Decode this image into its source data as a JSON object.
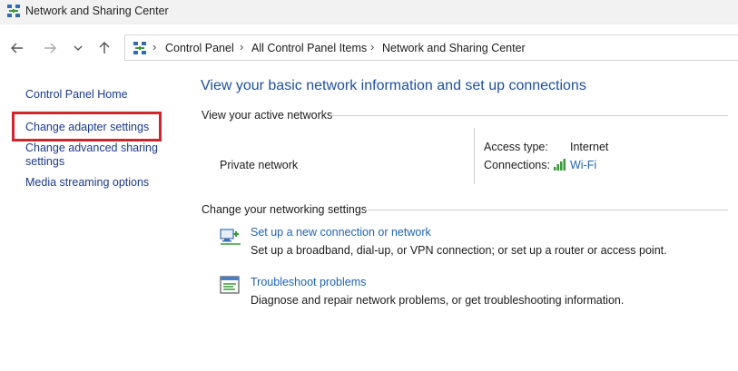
{
  "window": {
    "title": "Network and Sharing Center"
  },
  "address": {
    "breadcrumbs": [
      "Control Panel",
      "All Control Panel Items",
      "Network and Sharing Center"
    ]
  },
  "sidebar": {
    "items": [
      {
        "label": "Control Panel Home"
      },
      {
        "label": "Change adapter settings",
        "highlighted": true
      },
      {
        "label_line1": "Change advanced sharing",
        "label_line2": "settings"
      },
      {
        "label": "Media streaming options"
      }
    ]
  },
  "main": {
    "heading": "View your basic network information and set up connections",
    "active_networks_label": "View your active networks",
    "network": {
      "name": "Private network",
      "access_type_label": "Access type:",
      "access_type_value": "Internet",
      "connections_label": "Connections:",
      "connections_value": "Wi-Fi"
    },
    "change_settings_label": "Change your networking settings",
    "tasks": [
      {
        "icon": "new-connection-icon",
        "title": "Set up a new connection or network",
        "description": "Set up a broadband, dial-up, or VPN connection; or set up a router or access point."
      },
      {
        "icon": "troubleshoot-icon",
        "title": "Troubleshoot problems",
        "description": "Diagnose and repair network problems, or get troubleshooting information."
      }
    ]
  },
  "colors": {
    "sidebar_link": "#1a3a8a",
    "heading": "#1e4f9c",
    "link": "#1e64b4",
    "highlight": "#d3232e"
  }
}
